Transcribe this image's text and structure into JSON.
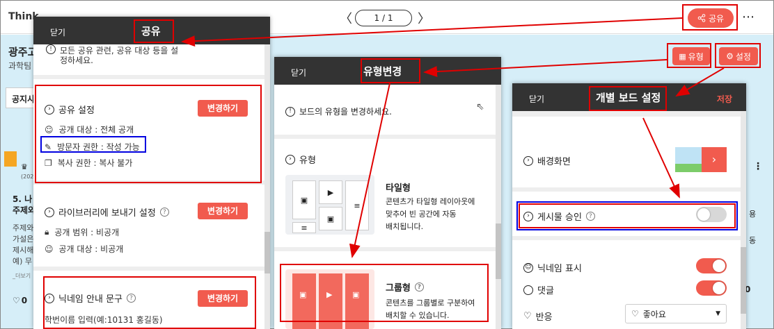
{
  "topbar": {
    "brand": "Think",
    "page_indicator": "1 / 1",
    "prev": "〈",
    "next": "〉",
    "share_label": "공유",
    "more": "⋯"
  },
  "board": {
    "title": "광주고",
    "subtitle": "과학팀",
    "notice_tab": "공지사",
    "type_label": "유형",
    "settings_label": "설정"
  },
  "background_cards": {
    "left_title_1": "5. 나",
    "left_title_2": "주제와",
    "left_lines": [
      "주제와",
      "가설은",
      "제시해",
      "예) 무"
    ],
    "left_more": "_더보기",
    "left_year": "(202",
    "left_count": "0",
    "right_letter_1": "용",
    "right_letter_2": "동",
    "right_count": "0"
  },
  "share_panel": {
    "close_label": "닫기",
    "title": "공유",
    "top_note_1": "모든 공유 관련, 공유 대상 등을 설",
    "top_note_2": "정하세요.",
    "share_settings": {
      "title": "공유 설정",
      "button": "변경하기",
      "lines": [
        "공개 대상 : 전체 공개",
        "방문자 권한 : 작성 가능",
        "복사 권한 : 복사 불가"
      ]
    },
    "library": {
      "title": "라이브러리에 보내기 설정",
      "button": "변경하기",
      "lines": [
        "공개 범위 : 비공개",
        "공개 대상 : 비공개"
      ]
    },
    "nickname": {
      "title": "닉네임 안내 문구",
      "button": "변경하기",
      "value": "학번이름 입력(예:10131 홍길동)"
    }
  },
  "type_panel": {
    "close_label": "닫기",
    "title": "유형변경",
    "notice": "보드의 유형을 변경하세요.",
    "section_title": "유형",
    "tile": {
      "name": "타일형",
      "desc_1": "콘텐츠가 타일형 레이아웃에",
      "desc_2": "맞추어 빈 공간에 자동",
      "desc_3": "배치됩니다."
    },
    "group": {
      "name": "그룹형",
      "desc_1": "콘텐츠를 그룹별로 구분하여",
      "desc_2": "배치할 수 있습니다."
    }
  },
  "settings_panel": {
    "close_label": "닫기",
    "title": "개별 보드 설정",
    "save_label": "저장",
    "background_label": "배경화면",
    "approval_label": "게시물 승인",
    "approval_on": false,
    "nickname_label": "닉네임 표시",
    "nickname_on": true,
    "comment_label": "댓글",
    "comment_on": true,
    "reaction_label": "반응",
    "reaction_value": "좋아요",
    "reaction_icon": "heart-icon"
  },
  "colors": {
    "accent": "#f15b4e",
    "highlight_red": "#e00000",
    "highlight_blue": "#0000e0",
    "panel_header": "#333333"
  }
}
